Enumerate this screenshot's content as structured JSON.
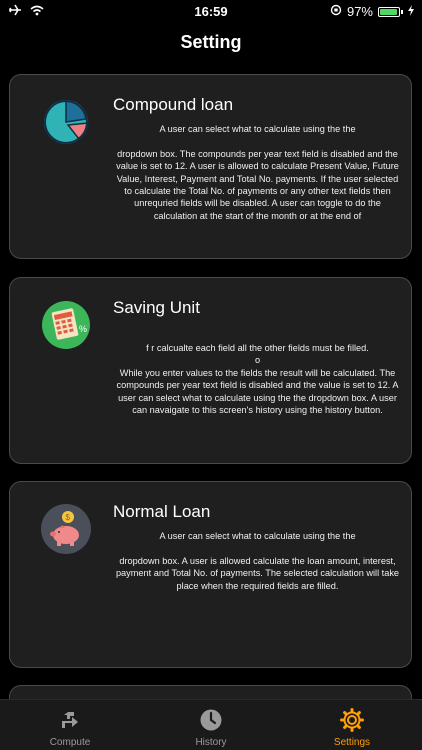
{
  "status": {
    "time": "16:59",
    "battery_percent": "97%",
    "battery_level": 0.97
  },
  "nav": {
    "title": "Setting"
  },
  "cards": [
    {
      "title": "Compound loan",
      "description": "A user can select what to calculate using the the\n\ndropdown box. The compounds per year text field is disabled and the value is set to 12. A user is allowed to calculate Present Value, Future Value, Interest, Payment and Total No. payments. If the user selected to calculate the Total No. of payments or any other text fields then unrequried fields will be disabled. A user can toggle to do the calculation at the start of the month or at the end of"
    },
    {
      "title": "Saving Unit",
      "description": "f  r calcualte each field all the other fields must be filled.\no\nWhile you enter values to the fields the result will be calculated. The compounds per year text field is disabled and the value is set to 12. A user can select what to calculate using the the dropdown box. A user can navaigate to this screen's history using the history button."
    },
    {
      "title": "Normal Loan",
      "description": "A user can select what to calculate using the the\n\ndropdown box. A user is allowed calculate the loan amount, interest, payment and Total No. of payments. The selected calculation will take place when the required fields are filled."
    }
  ],
  "tabs": [
    {
      "label": "Compute",
      "icon": "compute-icon",
      "active": false
    },
    {
      "label": "History",
      "icon": "history-icon",
      "active": false
    },
    {
      "label": "Settings",
      "icon": "settings-gear-icon",
      "active": true
    }
  ],
  "colors": {
    "accent": "#ff9f0a",
    "card_bg": "#1f1f1f",
    "card_border": "#4a4a4a",
    "battery": "#4cd964"
  }
}
